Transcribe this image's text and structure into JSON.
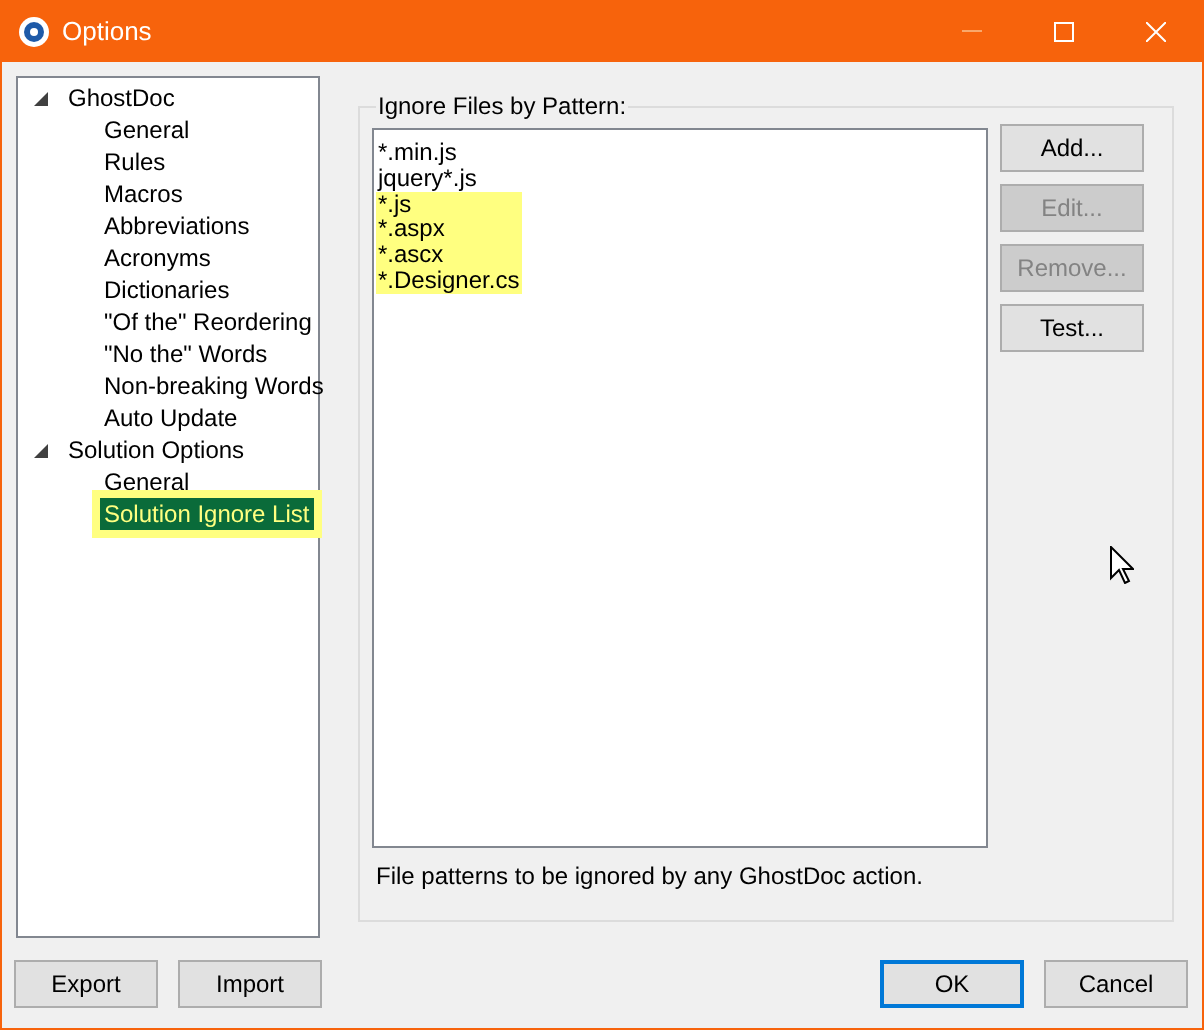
{
  "window": {
    "title": "Options"
  },
  "tree": [
    {
      "label": "GhostDoc",
      "expanded": true,
      "selected": false,
      "highlighted": false,
      "children": [
        {
          "label": "General",
          "selected": false,
          "highlighted": false
        },
        {
          "label": "Rules",
          "selected": false,
          "highlighted": false
        },
        {
          "label": "Macros",
          "selected": false,
          "highlighted": false
        },
        {
          "label": "Abbreviations",
          "selected": false,
          "highlighted": false
        },
        {
          "label": "Acronyms",
          "selected": false,
          "highlighted": false
        },
        {
          "label": "Dictionaries",
          "selected": false,
          "highlighted": false
        },
        {
          "label": "\"Of the\" Reordering",
          "selected": false,
          "highlighted": false
        },
        {
          "label": "\"No the\" Words",
          "selected": false,
          "highlighted": false
        },
        {
          "label": "Non-breaking Words",
          "selected": false,
          "highlighted": false
        },
        {
          "label": "Auto Update",
          "selected": false,
          "highlighted": false
        }
      ]
    },
    {
      "label": "Solution Options",
      "expanded": true,
      "selected": false,
      "highlighted": false,
      "children": [
        {
          "label": "General",
          "selected": false,
          "highlighted": false
        },
        {
          "label": "Solution Ignore List",
          "selected": true,
          "highlighted": true
        }
      ]
    }
  ],
  "group": {
    "title": "Ignore Files by Pattern:",
    "patterns": [
      {
        "text": "*.min.js",
        "highlighted": false
      },
      {
        "text": "jquery*.js",
        "highlighted": false
      },
      {
        "text": "*.js",
        "highlighted": true
      },
      {
        "text": "*.aspx",
        "highlighted": true
      },
      {
        "text": "*.ascx",
        "highlighted": true
      },
      {
        "text": "*.Designer.cs",
        "highlighted": true
      }
    ],
    "buttons": [
      {
        "label": "Add...",
        "disabled": false
      },
      {
        "label": "Edit...",
        "disabled": true
      },
      {
        "label": "Remove...",
        "disabled": true
      },
      {
        "label": "Test...",
        "disabled": false
      }
    ],
    "hint": "File patterns to be ignored by any GhostDoc action."
  },
  "footer": {
    "left": [
      {
        "label": "Export",
        "default": false
      },
      {
        "label": "Import",
        "default": false
      }
    ],
    "right": [
      {
        "label": "OK",
        "default": true
      },
      {
        "label": "Cancel",
        "default": false
      }
    ]
  }
}
